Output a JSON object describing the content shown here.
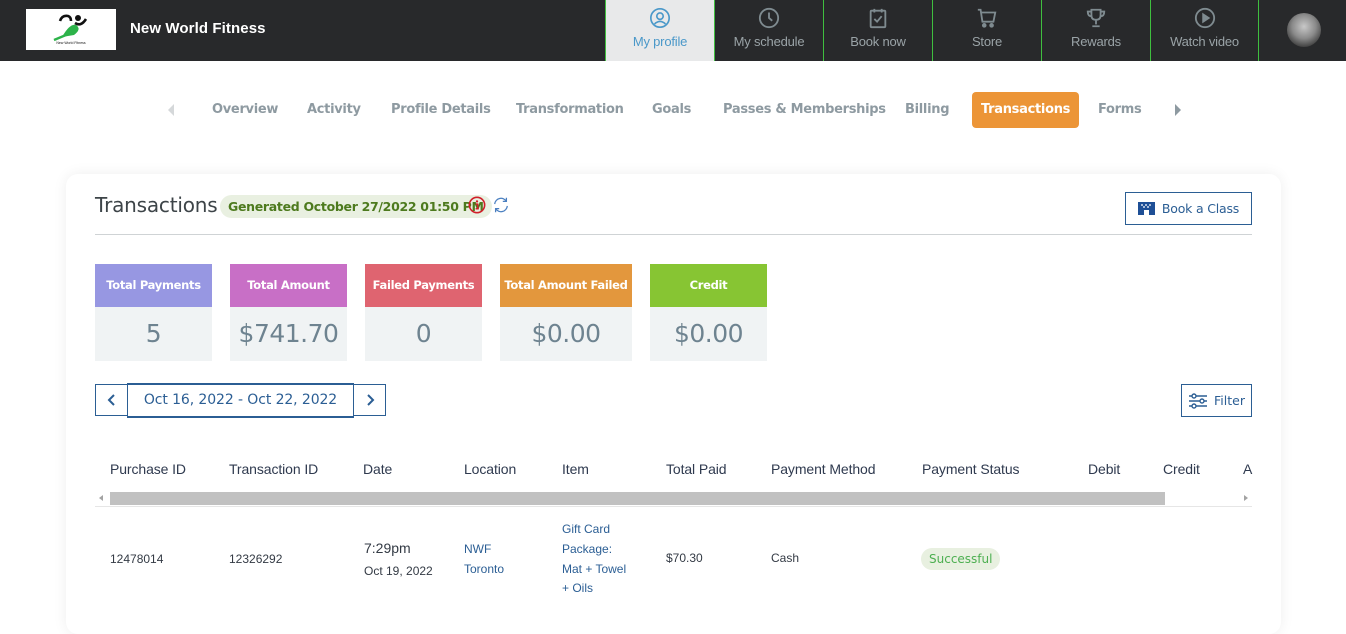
{
  "app": {
    "brand": "New World Fitness",
    "logo_caption": "New World Fitness"
  },
  "topnav": {
    "items": [
      {
        "label": "My profile",
        "icon": "user-circle-icon",
        "active": true
      },
      {
        "label": "My schedule",
        "icon": "clock-icon",
        "active": false
      },
      {
        "label": "Book now",
        "icon": "calendar-check-icon",
        "active": false
      },
      {
        "label": "Store",
        "icon": "cart-icon",
        "active": false
      },
      {
        "label": "Rewards",
        "icon": "trophy-icon",
        "active": false
      },
      {
        "label": "Watch video",
        "icon": "play-circle-icon",
        "active": false
      }
    ],
    "avatar": "user-avatar"
  },
  "tabs": {
    "items": [
      {
        "label": "Overview"
      },
      {
        "label": "Activity"
      },
      {
        "label": "Profile Details"
      },
      {
        "label": "Transformation"
      },
      {
        "label": "Goals"
      },
      {
        "label": "Passes & Memberships"
      },
      {
        "label": "Billing"
      },
      {
        "label": "Transactions",
        "active": true
      },
      {
        "label": "Forms"
      }
    ]
  },
  "transactions": {
    "title": "Transactions",
    "generated": "Generated October 27/2022 01:50 PM",
    "book_class_label": "Book a Class",
    "stats": [
      {
        "label": "Total Payments",
        "value": "5",
        "color": "#9797e2"
      },
      {
        "label": "Total Amount",
        "value": "$741.70",
        "color": "#c86fc6"
      },
      {
        "label": "Failed Payments",
        "value": "0",
        "color": "#df6470"
      },
      {
        "label": "Total Amount Failed",
        "value": "$0.00",
        "color": "#e3973d"
      },
      {
        "label": "Credit",
        "value": "$0.00",
        "color": "#87c533"
      }
    ],
    "date_range": "Oct 16, 2022 - Oct 22, 2022",
    "filter_label": "Filter",
    "columns": [
      "Purchase ID",
      "Transaction ID",
      "Date",
      "Location",
      "Item",
      "Total Paid",
      "Payment Method",
      "Payment Status",
      "Debit",
      "Credit",
      "A"
    ],
    "rows": [
      {
        "purchase_id": "12478014",
        "transaction_id": "12326292",
        "time": "7:29pm",
        "date": "Oct 19, 2022",
        "location_line1": "NWF",
        "location_line2": "Toronto",
        "item_lines": [
          "Gift Card",
          "Package:",
          "Mat + Towel",
          "+ Oils"
        ],
        "total_paid": "$70.30",
        "payment_method": "Cash",
        "payment_status": "Successful"
      }
    ]
  },
  "colors": {
    "accent_orange": "#ec9537",
    "primary_blue": "#2b5e94",
    "topbar": "#28292b",
    "nav_divider": "#3fbf3f"
  }
}
